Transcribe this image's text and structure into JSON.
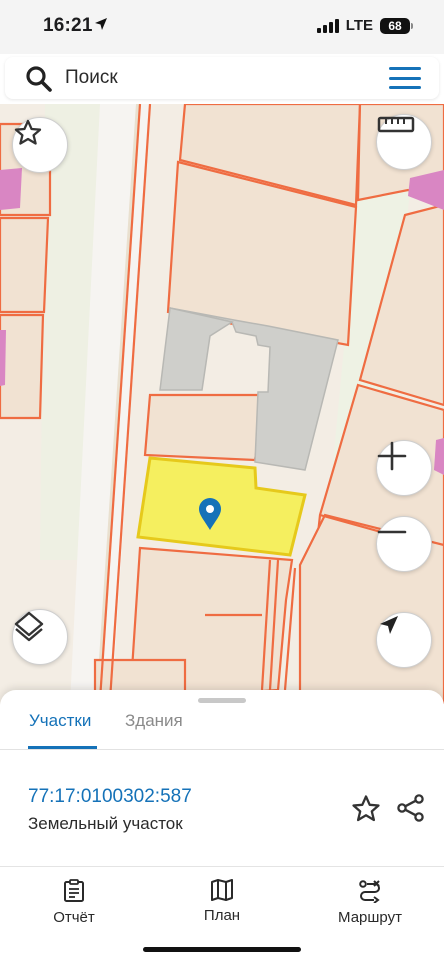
{
  "status_bar": {
    "time": "16:21",
    "network": "LTE",
    "battery": "68"
  },
  "search": {
    "placeholder": "Поиск"
  },
  "map": {
    "colors": {
      "parcel_border": "#ef6c42",
      "selected_parcel": "#f5ef5f",
      "building": "#cfcfcb",
      "road": "#f6f4f1"
    },
    "controls": [
      "favorite-icon",
      "ruler-icon",
      "zoom-in-icon",
      "zoom-out-icon",
      "layers-icon",
      "location-arrow-icon"
    ]
  },
  "sheet": {
    "tabs": [
      {
        "label": "Участки",
        "active": true
      },
      {
        "label": "Здания",
        "active": false
      }
    ],
    "parcel": {
      "cadastral_number": "77:17:0100302:587",
      "type": "Земельный участок"
    }
  },
  "bottom_nav": [
    {
      "label": "Отчёт",
      "icon": "report-icon"
    },
    {
      "label": "План",
      "icon": "map-plan-icon"
    },
    {
      "label": "Маршрут",
      "icon": "route-icon"
    }
  ],
  "accent_color": "#1572b8"
}
